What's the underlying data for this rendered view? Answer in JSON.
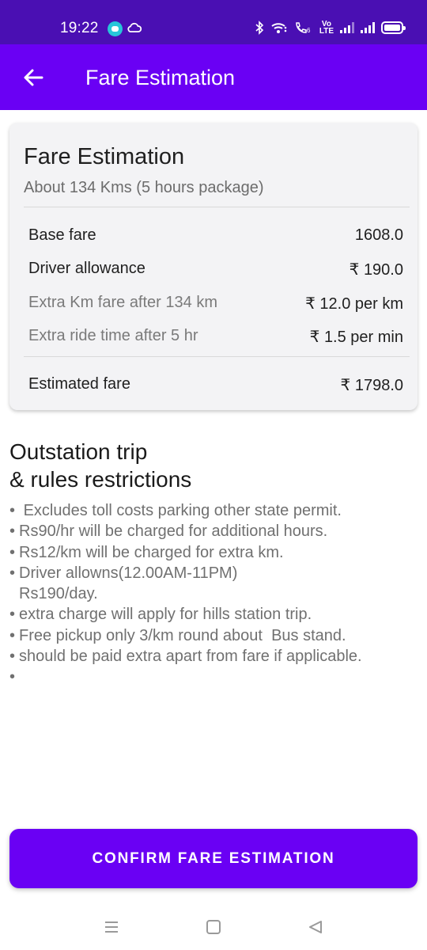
{
  "status_bar": {
    "time": "19:22",
    "icons": [
      "chat-bubble-icon",
      "cloud-icon",
      "bluetooth-icon",
      "wifi-icon",
      "wifi-calling-icon",
      "volte-icon",
      "signal-icon",
      "signal-icon",
      "battery-icon"
    ],
    "vo_label": "Vo",
    "lte_label": "LTE",
    "wifi_badge": "6"
  },
  "app_bar": {
    "title": "Fare Estimation",
    "back_icon": "arrow-left-icon"
  },
  "fare_card": {
    "title": "Fare Estimation",
    "subtitle": "About 134 Kms (5 hours package)",
    "rows": [
      {
        "label": "Base fare",
        "value": "1608.0"
      },
      {
        "label": "Driver allowance",
        "value": "₹ 190.0"
      },
      {
        "label": "Extra Km fare after 134 km",
        "value": "₹ 12.0 per km"
      },
      {
        "label": "Extra ride time after 5 hr",
        "value": "₹ 1.5 per min"
      }
    ],
    "total": {
      "label": "Estimated fare",
      "value": "₹ 1798.0"
    }
  },
  "rules": {
    "title_line1": "Outstation trip",
    "title_line2": "& rules restrictions",
    "items": [
      " Excludes toll costs parking other state permit.",
      "Rs90/hr will be charged for additional hours.",
      "Rs12/km will be charged for extra km.",
      "Driver allowns(12.00AM-11PM)\nRs190/day.",
      "extra charge will apply for hills station trip.",
      "Free pickup only 3/km round about  Bus stand.",
      "should be paid extra apart from fare if applicable.",
      ""
    ]
  },
  "confirm_button": {
    "label": "CONFIRM FARE ESTIMATION"
  },
  "colors": {
    "status_bar": "#4a0fb3",
    "primary": "#6a00f4",
    "card_bg": "#f3f3f5",
    "muted_text": "#707070"
  },
  "nav_bar": {
    "icons": [
      "recent-apps-icon",
      "home-icon",
      "back-triangle-icon"
    ]
  }
}
